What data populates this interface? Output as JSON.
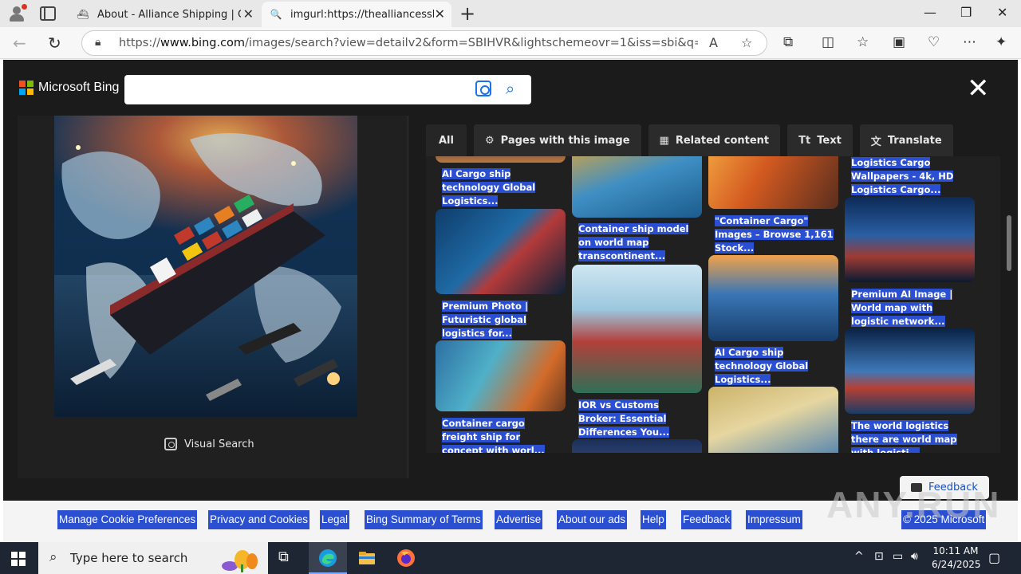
{
  "browser": {
    "tabs": [
      {
        "title": "About - Alliance Shipping | Cargo",
        "active": false
      },
      {
        "title": "imgurl:https://thealliancesshipping",
        "active": true
      }
    ],
    "url_prefix": "https://",
    "url_host": "www.bing.com",
    "url_rest": "/images/search?view=detailv2&form=SBIHVR&lightschemeovr=1&iss=sbi&q=imgurl:https%..."
  },
  "bing": {
    "brand": "Microsoft Bing",
    "search_value": "",
    "visual_search_label": "Visual Search",
    "tabs": [
      {
        "label": "All",
        "icon": ""
      },
      {
        "label": "Pages with this image",
        "icon": "pages-icon"
      },
      {
        "label": "Related content",
        "icon": "grid-icon"
      },
      {
        "label": "Text",
        "icon": "text-icon"
      },
      {
        "label": "Translate",
        "icon": "translate-icon"
      }
    ],
    "results": [
      {
        "caption": "AI Cargo ship technology Global Logistics..."
      },
      {
        "caption": "Premium Photo | Futuristic global logistics for..."
      },
      {
        "caption": "Container cargo freight ship for concept with worl..."
      },
      {
        "caption": "Container ship model on world map transcontinent..."
      },
      {
        "caption": "IOR vs Customs Broker: Essential Differences You..."
      },
      {
        "caption": "\"Container Cargo\" Images – Browse 1,161 Stock..."
      },
      {
        "caption": "AI Cargo ship technology Global Logistics..."
      },
      {
        "caption": "Logistics Cargo Wallpapers - 4k, HD Logistics Cargo..."
      },
      {
        "caption": "Premium AI Image | World map with logistic network..."
      },
      {
        "caption": "The world logistics there are world map with logisti..."
      }
    ],
    "feedback_label": "Feedback"
  },
  "footer": {
    "links": [
      "Manage Cookie Preferences",
      "Privacy and Cookies",
      "Legal",
      "Bing Summary of Terms",
      "Advertise",
      "About our ads",
      "Help",
      "Feedback",
      "Impressum",
      "© 2025 Microsoft"
    ]
  },
  "watermark": "ANY.RUN",
  "taskbar": {
    "search_placeholder": "Type here to search",
    "time": "10:11 AM",
    "date": "6/24/2025"
  },
  "colors": {
    "overlay_bg": "#1b1b1b",
    "link_highlight": "#2b4fd1",
    "accent": "#1a73e8"
  }
}
